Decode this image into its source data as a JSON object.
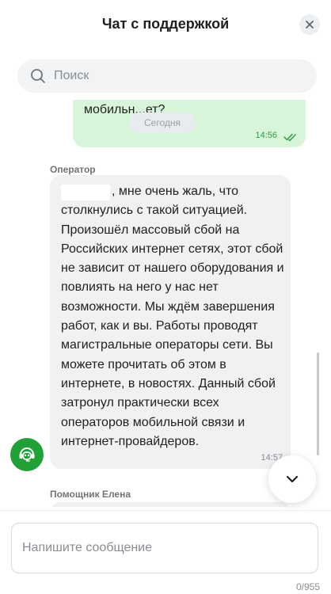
{
  "header": {
    "title": "Чат с поддержкой"
  },
  "search": {
    "placeholder": "Поиск"
  },
  "messages": {
    "outgoing_partial": {
      "text": "мобильн...ет?",
      "time": "14:56"
    },
    "date_separator": "Сегодня",
    "operator": {
      "sender": "Оператор",
      "text": ", мне очень жаль, что столкнулись с такой ситуацией. Произошёл массовый сбой на Российских интернет сетях, этот сбой не зависит от нашего оборудования и повлиять на него у нас нет возможности. Мы ждём завершения работ, как и вы. Работы проводят магистральные операторы сети. Вы можете прочитать об этом в интернете, в новостях. Данный сбой затронул практически всех операторов мобильной связи и интернет-провайдеров.",
      "time": "14:57"
    },
    "next_sender": "Помощник Елена"
  },
  "composer": {
    "placeholder": "Напишите сообщение",
    "counter": "0/955"
  },
  "colors": {
    "accent": "#21a038",
    "outgoing_bubble": "#d9f5d9",
    "incoming_bubble": "#f0f1f2"
  },
  "icons": {
    "close": "close-icon",
    "search": "search-icon",
    "avatar": "headset-bot-icon",
    "scroll": "chevron-down-icon",
    "read": "double-check-icon"
  }
}
